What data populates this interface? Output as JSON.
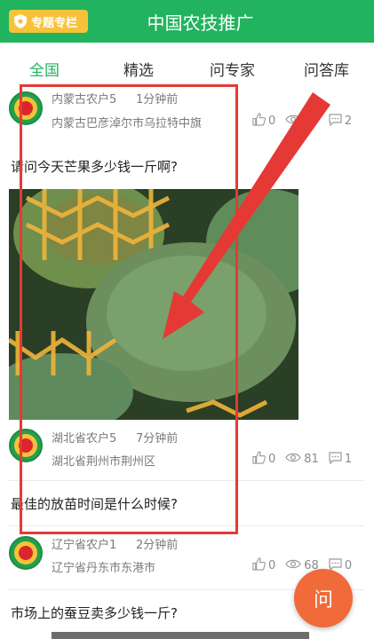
{
  "header": {
    "special_label": "专题专栏",
    "title": "中国农技推广"
  },
  "tabs": [
    {
      "label": "全国",
      "active": true
    },
    {
      "label": "精选",
      "active": false
    },
    {
      "label": "问专家",
      "active": false
    },
    {
      "label": "问答库",
      "active": false
    }
  ],
  "posts": [
    {
      "user": "内蒙古农户5",
      "time": "1分钟前",
      "location": "内蒙古巴彦淖尔市乌拉特中旗",
      "likes": "0",
      "views": "90",
      "comments": "2",
      "question": "请问今天芒果多少钱一斤啊?"
    },
    {
      "user": "湖北省农户5",
      "time": "7分钟前",
      "location": "湖北省荆州市荆州区",
      "likes": "0",
      "views": "81",
      "comments": "1",
      "question": "最佳的放苗时间是什么时候?"
    },
    {
      "user": "辽宁省农户1",
      "time": "2分钟前",
      "location": "辽宁省丹东市东港市",
      "likes": "0",
      "views": "68",
      "comments": "0",
      "question": "市场上的蚕豆卖多少钱一斤?"
    }
  ],
  "fab": {
    "label": "问"
  },
  "colors": {
    "brand_green": "#22b35e",
    "special_yellow": "#f7c23a",
    "fab_orange": "#f06a3a",
    "annotation_red": "#e53935"
  },
  "icons": {
    "like": "thumb-up-icon",
    "view": "eye-icon",
    "comment": "comment-icon"
  }
}
